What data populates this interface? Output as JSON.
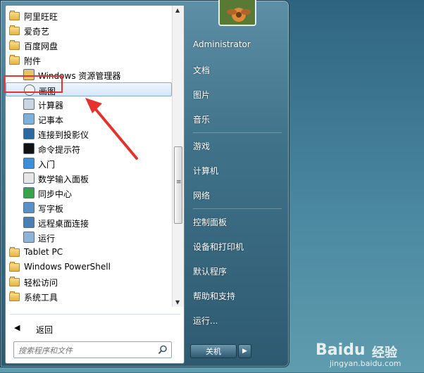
{
  "programs": [
    {
      "label": "阿里旺旺",
      "icon": "folder-icon"
    },
    {
      "label": "爱奇艺",
      "icon": "folder-icon"
    },
    {
      "label": "百度网盘",
      "icon": "folder-icon"
    },
    {
      "label": "附件",
      "icon": "folder-icon"
    },
    {
      "label": "Windows 资源管理器",
      "icon": "explorer-icon"
    },
    {
      "label": "画图",
      "icon": "paint-icon"
    },
    {
      "label": "计算器",
      "icon": "calculator-icon"
    },
    {
      "label": "记事本",
      "icon": "notepad-icon"
    },
    {
      "label": "连接到投影仪",
      "icon": "projector-icon"
    },
    {
      "label": "命令提示符",
      "icon": "cmd-icon"
    },
    {
      "label": "入门",
      "icon": "getting-started-icon"
    },
    {
      "label": "数学输入面板",
      "icon": "math-input-icon"
    },
    {
      "label": "同步中心",
      "icon": "sync-icon"
    },
    {
      "label": "写字板",
      "icon": "wordpad-icon"
    },
    {
      "label": "远程桌面连接",
      "icon": "remote-desktop-icon"
    },
    {
      "label": "运行",
      "icon": "run-icon"
    },
    {
      "label": "Tablet PC",
      "icon": "folder-icon"
    },
    {
      "label": "Windows PowerShell",
      "icon": "folder-icon"
    },
    {
      "label": "轻松访问",
      "icon": "folder-icon"
    },
    {
      "label": "系统工具",
      "icon": "folder-icon"
    }
  ],
  "back_label": "返回",
  "search": {
    "placeholder": "搜索程序和文件"
  },
  "right_menu": [
    "Administrator",
    "文档",
    "图片",
    "音乐",
    "游戏",
    "计算机",
    "网络",
    "控制面板",
    "设备和打印机",
    "默认程序",
    "帮助和支持",
    "运行..."
  ],
  "shutdown_label": "关机",
  "watermark": {
    "brand": "Baidu",
    "text": "经验",
    "url": "jingyan.baidu.com"
  },
  "colors": {
    "highlight": "#e5322d",
    "selection": "#d4e6f8"
  }
}
